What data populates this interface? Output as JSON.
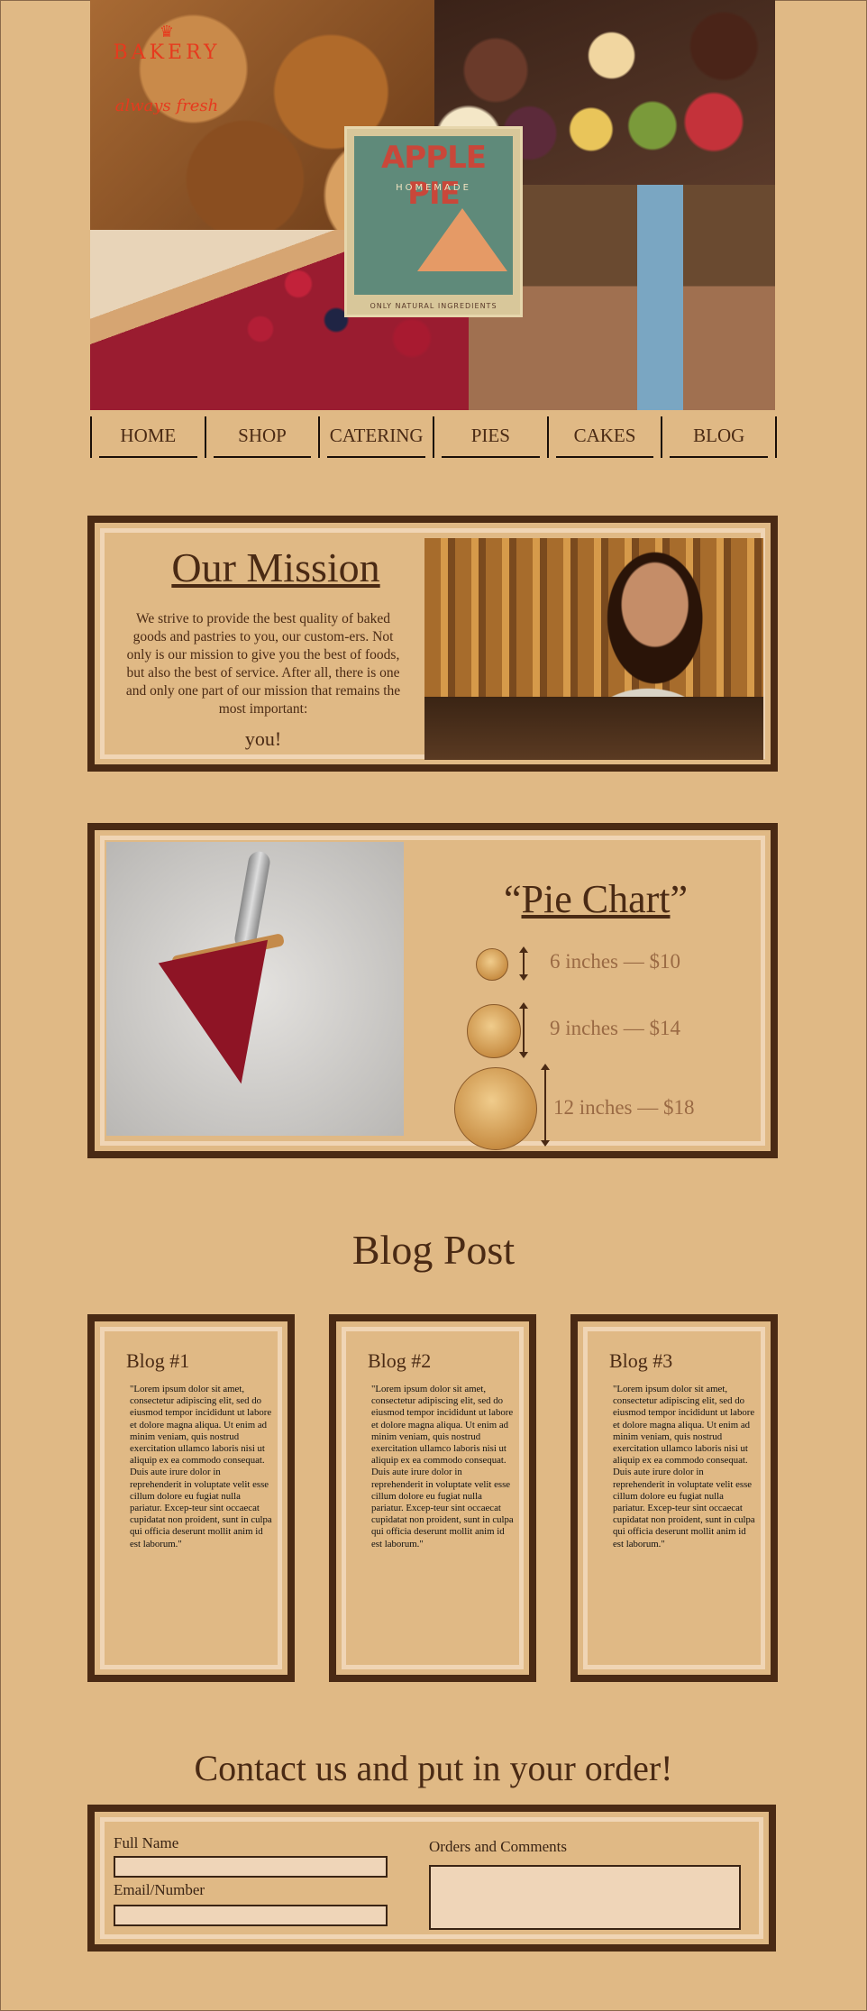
{
  "hero": {
    "badge_top": "BAKERY",
    "badge_tag": "always fresh",
    "poster_title": "APPLE PIE",
    "poster_sub": "HOMEMADE",
    "poster_foot": "ONLY NATURAL INGREDIENTS"
  },
  "nav": [
    "HOME",
    "SHOP",
    "CATERING",
    "PIES",
    "CAKES",
    "BLOG"
  ],
  "mission": {
    "title": "Our Mission",
    "body": "We strive to provide the best quality of baked goods and pastries to you, our custom-ers. Not only is our mission to give you the best of foods, but also the best of service. After all, there is one and only one part of our mission that remains the most important:",
    "emphasis": "you!"
  },
  "pie_chart": {
    "title_open": "“",
    "title_word": "Pie Chart",
    "title_close": "”",
    "sizes": [
      {
        "label": "6 inches — $10"
      },
      {
        "label": "9 inches — $14"
      },
      {
        "label": "12 inches — $18"
      }
    ]
  },
  "blog": {
    "heading": "Blog Post",
    "posts": [
      {
        "title": "Blog #1",
        "body": "\"Lorem ipsum dolor sit amet, consectetur adipiscing elit, sed do eiusmod tempor incididunt ut labore et dolore magna aliqua. Ut enim ad minim veniam, quis nostrud exercitation ullamco laboris nisi ut aliquip ex ea commodo consequat. Duis aute irure dolor in reprehenderit in voluptate velit esse cillum dolore eu fugiat nulla pariatur. Excep-teur sint occaecat cupidatat non proident, sunt in culpa qui officia deserunt mollit anim id est laborum.\""
      },
      {
        "title": "Blog #2",
        "body": "\"Lorem ipsum dolor sit amet, consectetur adipiscing elit, sed do eiusmod tempor incididunt ut labore et dolore magna aliqua. Ut enim ad minim veniam, quis nostrud exercitation ullamco laboris nisi ut aliquip ex ea commodo consequat. Duis aute irure dolor in reprehenderit in voluptate velit esse cillum dolore eu fugiat nulla pariatur. Excep-teur sint occaecat cupidatat non proident, sunt in culpa qui officia deserunt mollit anim id est laborum.\""
      },
      {
        "title": "Blog #3",
        "body": "\"Lorem ipsum dolor sit amet, consectetur adipiscing elit, sed do eiusmod tempor incididunt ut labore et dolore magna aliqua. Ut enim ad minim veniam, quis nostrud exercitation ullamco laboris nisi ut aliquip ex ea commodo consequat. Duis aute irure dolor in reprehenderit in voluptate velit esse cillum dolore eu fugiat nulla pariatur. Excep-teur sint occaecat cupidatat non proident, sunt in culpa qui officia deserunt mollit anim id est laborum.\""
      }
    ]
  },
  "contact": {
    "heading": "Contact us and put in your order!",
    "name_label": "Full Name",
    "name_value": "",
    "contact_label": "Email/Number",
    "contact_value": "",
    "orders_label": "Orders and Comments",
    "orders_value": ""
  },
  "colors": {
    "page": "#e0b985",
    "frame": "#4a2a14",
    "frame_inner": "#f0d5b5",
    "price_text": "#9a6a44"
  }
}
